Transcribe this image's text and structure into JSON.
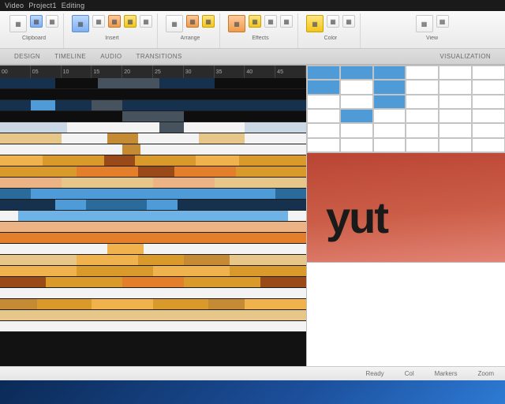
{
  "title": {
    "app": "Video",
    "doc": "Project1",
    "suffix": "Editing"
  },
  "ribbon": {
    "groups": [
      {
        "id": "clipboard",
        "label": "Clipboard",
        "btns": [
          "paste",
          "cut",
          "copy"
        ]
      },
      {
        "id": "insert",
        "label": "Insert",
        "btns": [
          "image",
          "shape",
          "text",
          "a",
          "b"
        ]
      },
      {
        "id": "arrange",
        "label": "Arrange",
        "btns": [
          "front",
          "back",
          "group"
        ]
      },
      {
        "id": "effects",
        "label": "Effects",
        "btns": [
          "fx1",
          "fx2",
          "fx3",
          "fx4"
        ]
      },
      {
        "id": "color",
        "label": "Color",
        "btns": [
          "fill",
          "outline",
          "swatch"
        ]
      },
      {
        "id": "view",
        "label": "View",
        "btns": [
          "zoom",
          "fit"
        ]
      }
    ]
  },
  "tabs": {
    "left": [
      "DESIGN",
      "TIMELINE",
      "AUDIO",
      "TRANSITIONS"
    ],
    "right": "VISUALIZATION"
  },
  "ruler_marks": [
    "00",
    "05",
    "10",
    "15",
    "20",
    "25",
    "30",
    "35",
    "40",
    "45"
  ],
  "tracks": [
    [
      [
        "c-navy",
        18
      ],
      [
        "c-black",
        14
      ],
      [
        "c-slate",
        20
      ],
      [
        "c-navy",
        18
      ],
      [
        "c-black",
        30
      ]
    ],
    [
      [
        "c-black",
        100
      ]
    ],
    [
      [
        "c-navy",
        10
      ],
      [
        "c-sky",
        8
      ],
      [
        "c-navy",
        12
      ],
      [
        "c-slate",
        10
      ],
      [
        "c-navy",
        60
      ]
    ],
    [
      [
        "c-black",
        40
      ],
      [
        "c-slate",
        20
      ],
      [
        "c-black",
        40
      ]
    ],
    [
      [
        "c-cloud",
        22
      ],
      [
        "c-white",
        30
      ],
      [
        "c-slate",
        8
      ],
      [
        "c-white",
        20
      ],
      [
        "c-cloud",
        20
      ]
    ],
    [
      [
        "c-sand",
        20
      ],
      [
        "c-white",
        15
      ],
      [
        "c-ochre",
        10
      ],
      [
        "c-white",
        20
      ],
      [
        "c-sand",
        15
      ],
      [
        "c-white",
        20
      ]
    ],
    [
      [
        "c-white",
        40
      ],
      [
        "c-ochre",
        6
      ],
      [
        "c-white",
        54
      ]
    ],
    [
      [
        "c-sun",
        14
      ],
      [
        "c-amber",
        20
      ],
      [
        "c-rust",
        10
      ],
      [
        "c-amber",
        20
      ],
      [
        "c-sun",
        14
      ],
      [
        "c-amber",
        22
      ]
    ],
    [
      [
        "c-amber",
        25
      ],
      [
        "c-orange",
        20
      ],
      [
        "c-rust",
        12
      ],
      [
        "c-orange",
        20
      ],
      [
        "c-amber",
        23
      ]
    ],
    [
      [
        "c-peach",
        20
      ],
      [
        "c-sand",
        30
      ],
      [
        "c-peach",
        20
      ],
      [
        "c-sand",
        30
      ]
    ],
    [
      [
        "c-teal",
        10
      ],
      [
        "c-sky",
        80
      ],
      [
        "c-teal",
        10
      ]
    ],
    [
      [
        "c-navy",
        18
      ],
      [
        "c-sky",
        10
      ],
      [
        "c-teal",
        20
      ],
      [
        "c-sky",
        10
      ],
      [
        "c-navy",
        42
      ]
    ],
    [
      [
        "c-white",
        6
      ],
      [
        "c-sky2",
        88
      ],
      [
        "c-white",
        6
      ]
    ],
    [
      [
        "c-peach",
        100
      ]
    ],
    [
      [
        "c-orange",
        100
      ]
    ],
    [
      [
        "c-white",
        35
      ],
      [
        "c-sun",
        12
      ],
      [
        "c-white",
        53
      ]
    ],
    [
      [
        "c-sand",
        25
      ],
      [
        "c-sun",
        20
      ],
      [
        "c-amber",
        15
      ],
      [
        "c-ochre",
        15
      ],
      [
        "c-sand",
        25
      ]
    ],
    [
      [
        "c-sun",
        25
      ],
      [
        "c-amber",
        25
      ],
      [
        "c-sun",
        25
      ],
      [
        "c-amber",
        25
      ]
    ],
    [
      [
        "c-rust",
        15
      ],
      [
        "c-amber",
        25
      ],
      [
        "c-orange",
        20
      ],
      [
        "c-amber",
        25
      ],
      [
        "c-rust",
        15
      ]
    ],
    [
      [
        "c-white",
        100
      ]
    ],
    [
      [
        "c-ochre",
        12
      ],
      [
        "c-amber",
        18
      ],
      [
        "c-sun",
        20
      ],
      [
        "c-amber",
        18
      ],
      [
        "c-ochre",
        12
      ],
      [
        "c-sun",
        20
      ]
    ],
    [
      [
        "c-sand",
        100
      ]
    ],
    [
      [
        "c-white",
        100
      ]
    ]
  ],
  "grid": {
    "rows": 6,
    "cols": 6,
    "selected": [
      [
        0,
        0
      ],
      [
        0,
        1
      ],
      [
        0,
        2
      ],
      [
        1,
        0
      ],
      [
        1,
        2
      ],
      [
        2,
        2
      ],
      [
        3,
        1
      ]
    ]
  },
  "logo": {
    "brand": "yut"
  },
  "status": {
    "items": [
      "Ready",
      "Col",
      "Markers",
      "Zoom"
    ]
  },
  "colors": {
    "accent": "#4f9bd8",
    "logo_bg_from": "#b94534",
    "logo_bg_to": "#e28374"
  }
}
